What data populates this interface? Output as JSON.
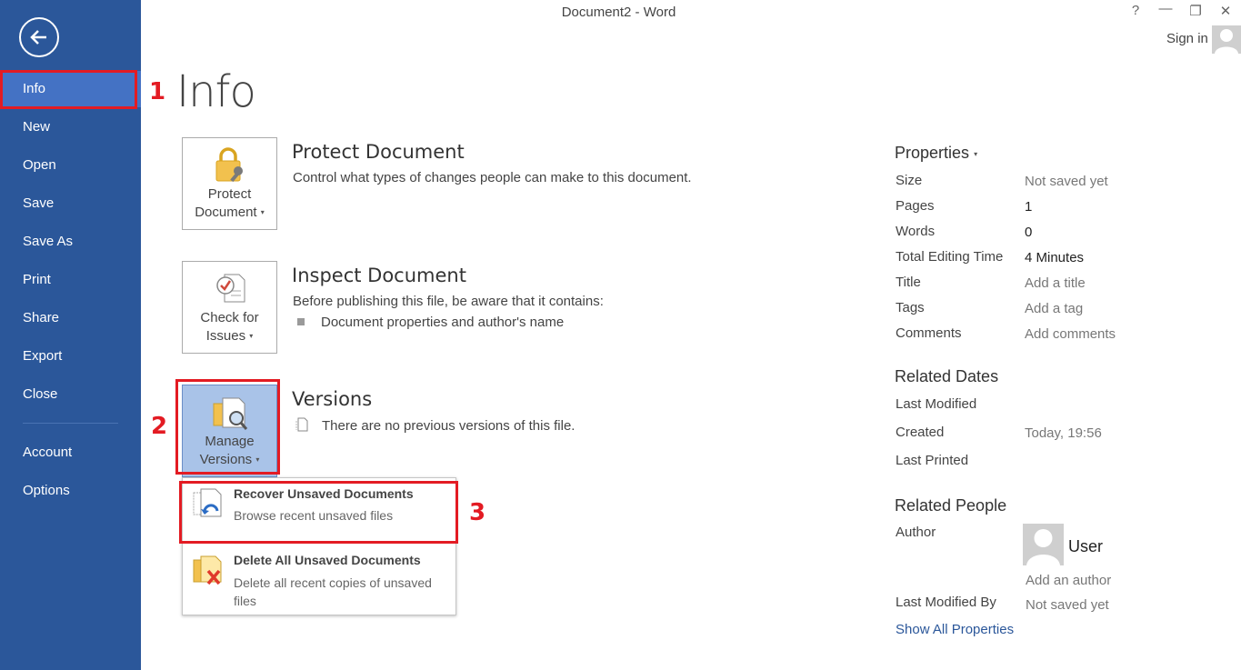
{
  "window": {
    "title": "Document2 - Word",
    "help": "?",
    "minimize": "—",
    "restore": "❐",
    "close": "✕",
    "sign_in": "Sign in"
  },
  "sidebar": {
    "items": [
      {
        "label": "Info",
        "active": true
      },
      {
        "label": "New"
      },
      {
        "label": "Open"
      },
      {
        "label": "Save"
      },
      {
        "label": "Save As"
      },
      {
        "label": "Print"
      },
      {
        "label": "Share"
      },
      {
        "label": "Export"
      },
      {
        "label": "Close"
      },
      {
        "label": "Account"
      },
      {
        "label": "Options"
      }
    ]
  },
  "page": {
    "title": "Info"
  },
  "protect": {
    "button_line1": "Protect",
    "button_line2": "Document",
    "title": "Protect Document",
    "description": "Control what types of changes people can make to this document."
  },
  "inspect": {
    "button_line1": "Check for",
    "button_line2": "Issues",
    "title": "Inspect Document",
    "description": "Before publishing this file, be aware that it contains:",
    "bullet": "Document properties and author's name"
  },
  "versions": {
    "button_line1": "Manage",
    "button_line2": "Versions",
    "title": "Versions",
    "description": "There are no previous versions of this file."
  },
  "versions_menu": {
    "recover_title": "Recover Unsaved Documents",
    "recover_desc": "Browse recent unsaved files",
    "delete_title": "Delete All Unsaved Documents",
    "delete_desc": "Delete all recent copies of unsaved files"
  },
  "annotations": {
    "n1": "1",
    "n2": "2",
    "n3": "3",
    "color": "#e31b23"
  },
  "properties": {
    "heading": "Properties",
    "size_label": "Size",
    "size_value": "Not saved yet",
    "pages_label": "Pages",
    "pages_value": "1",
    "words_label": "Words",
    "words_value": "0",
    "editing_label": "Total Editing Time",
    "editing_value": "4 Minutes",
    "title_label": "Title",
    "title_value": "Add a title",
    "tags_label": "Tags",
    "tags_value": "Add a tag",
    "comments_label": "Comments",
    "comments_value": "Add comments"
  },
  "related_dates": {
    "heading": "Related Dates",
    "last_modified_label": "Last Modified",
    "created_label": "Created",
    "created_value": "Today, 19:56",
    "last_printed_label": "Last Printed"
  },
  "related_people": {
    "heading": "Related People",
    "author_label": "Author",
    "author_name": "User",
    "add_author": "Add an author",
    "last_modified_by_label": "Last Modified By",
    "last_modified_by_value": "Not saved yet"
  },
  "show_all": "Show All Properties",
  "colors": {
    "sidebar": "#2b579a",
    "sidebar_active": "#4472c4",
    "link": "#2b579a"
  }
}
